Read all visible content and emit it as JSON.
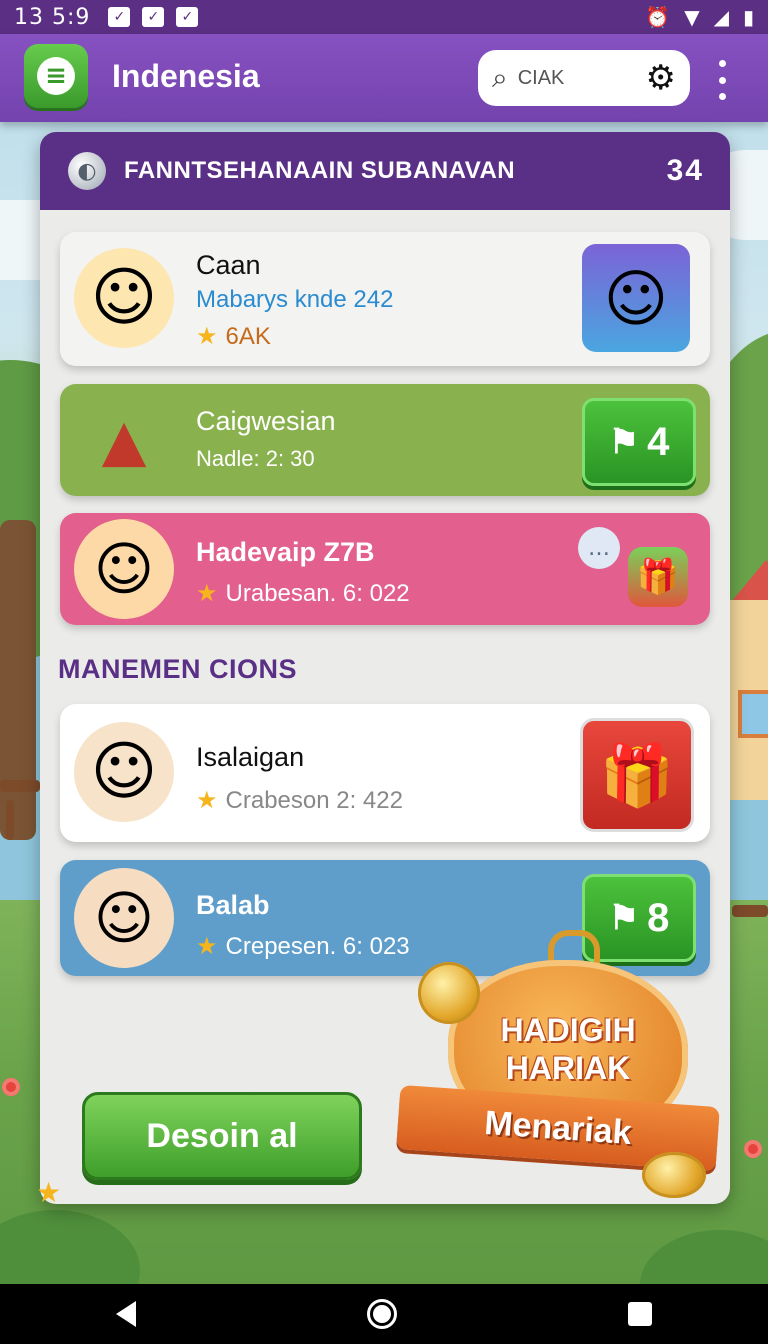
{
  "status_bar": {
    "time": "13 5:9",
    "left_icons": [
      "notification-check-icon",
      "notification-check-icon",
      "notification-check-icon"
    ],
    "right_icons": [
      "alarm-icon",
      "wifi-icon",
      "signal-icon",
      "battery-icon"
    ]
  },
  "app_bar": {
    "title": "Indenesia",
    "search_text": "CIAK",
    "icons": [
      "app-logo-icon",
      "search-icon",
      "gear-icon",
      "more-icon"
    ]
  },
  "panel": {
    "title": "FANNTSEHANAAIN SUBANAVAN",
    "count": "34",
    "cards": [
      {
        "name": "Caan",
        "subtitle": "Mabarys knde 242",
        "meta": "6AK",
        "color": "#f3f3f1"
      },
      {
        "name": "Caigwesian",
        "subtitle": "Nadle: 2: 30",
        "badge_count": "4",
        "color": "#89b24e"
      },
      {
        "name": "Hadevaip Z7B",
        "subtitle": "Urabesan. 6: 022",
        "color": "#e35f8d"
      }
    ],
    "section_label": "MANEMEN CIONS",
    "section_cards": [
      {
        "name": "Isalaigan",
        "subtitle": "Crabeson 2: 422",
        "color": "#ffffff"
      },
      {
        "name": "Balab",
        "subtitle": "Crepesen. 6: 023",
        "badge_count": "8",
        "color": "#5f9ecb"
      }
    ],
    "cta_label": "Desoin al"
  },
  "reward_badge": {
    "line1": "HADIGIH",
    "line2": "HARIAK",
    "ribbon": "Menariak"
  },
  "colors": {
    "app_bar": "#7a47b4",
    "panel_header": "#5a2f86",
    "green_button": "#3e9f2a",
    "star": "#f6b51d"
  }
}
